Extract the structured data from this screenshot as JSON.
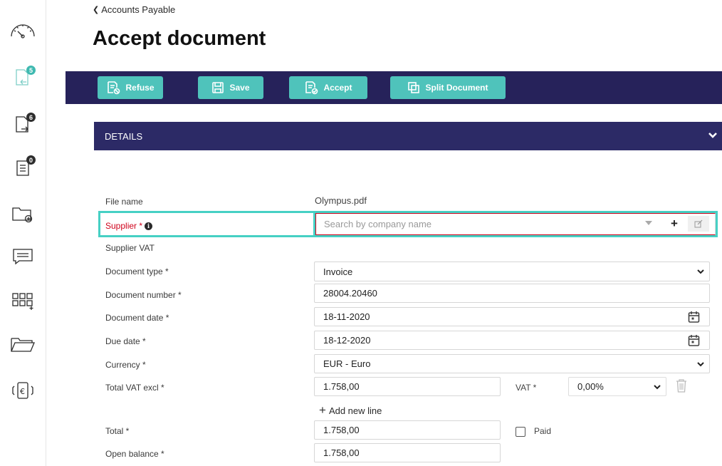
{
  "breadcrumb": {
    "label": "Accounts Payable"
  },
  "page": {
    "title": "Accept document"
  },
  "sidebar": {
    "badges": {
      "inbox": "5",
      "outbox": "6",
      "list": "0"
    }
  },
  "toolbar": {
    "refuse": "Refuse",
    "save": "Save",
    "accept": "Accept",
    "split": "Split Document"
  },
  "details": {
    "header": "DETAILS",
    "labels": {
      "file_name": "File name",
      "supplier": "Supplier *",
      "supplier_vat": "Supplier VAT",
      "document_type": "Document type *",
      "document_number": "Document number *",
      "document_date": "Document date *",
      "due_date": "Due date *",
      "currency": "Currency *",
      "total_vat_excl": "Total VAT excl *",
      "vat": "VAT *",
      "total": "Total *",
      "paid": "Paid",
      "open_balance": "Open balance *"
    },
    "values": {
      "file_name": "Olympus.pdf",
      "supplier_placeholder": "Search by company name",
      "document_type": "Invoice",
      "document_number": "28004.20460",
      "document_date": "18-11-2020",
      "due_date": "18-12-2020",
      "currency": "EUR - Euro",
      "total_vat_excl": "1.758,00",
      "vat_rate": "0,00%",
      "total": "1.758,00",
      "open_balance": "1.758,00"
    },
    "add_line": "Add new line"
  }
}
